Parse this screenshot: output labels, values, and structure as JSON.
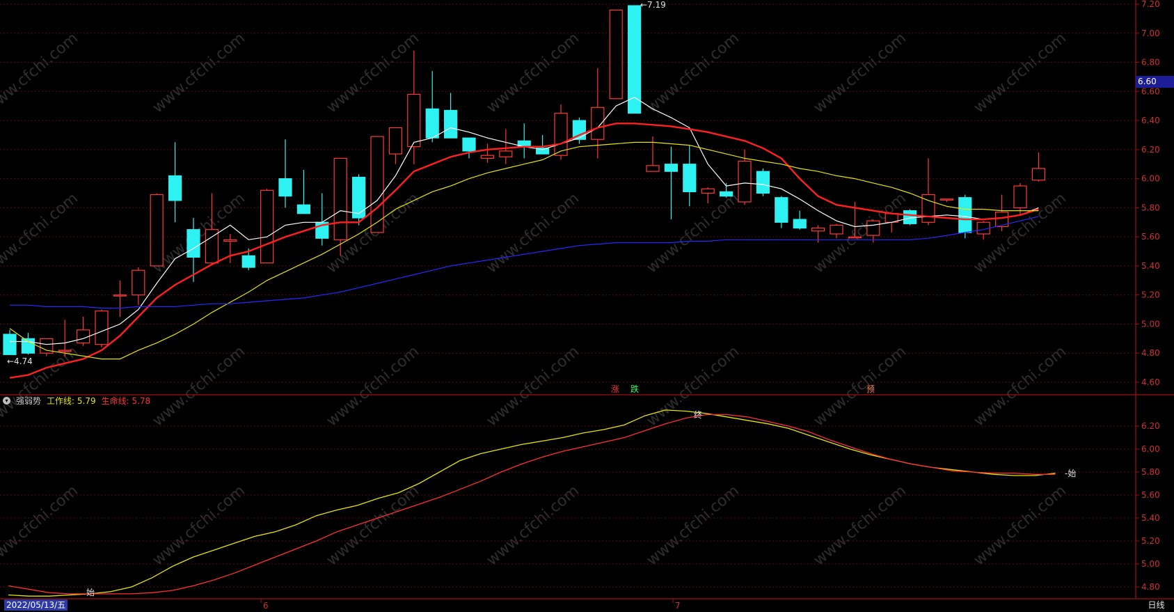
{
  "chart_data": [
    {
      "type": "candlestick",
      "panel": "price",
      "ylim": [
        4.6,
        7.2
      ],
      "yticks": [
        "4.60",
        "4.80",
        "5.00",
        "5.20",
        "5.40",
        "5.60",
        "5.80",
        "6.00",
        "6.20",
        "6.40",
        "6.60",
        "6.80",
        "7.00",
        "7.20"
      ],
      "grid": true,
      "candles": [
        {
          "o": 4.93,
          "h": 4.96,
          "l": 4.79,
          "c": 4.79
        },
        {
          "o": 4.9,
          "h": 4.94,
          "l": 4.79,
          "c": 4.8
        },
        {
          "o": 4.8,
          "h": 4.88,
          "l": 4.78,
          "c": 4.9
        },
        {
          "o": 4.82,
          "h": 5.03,
          "l": 4.78,
          "c": 4.82
        },
        {
          "o": 4.87,
          "h": 5.05,
          "l": 4.85,
          "c": 4.96
        },
        {
          "o": 4.86,
          "h": 5.1,
          "l": 4.84,
          "c": 5.09
        },
        {
          "o": 5.2,
          "h": 5.3,
          "l": 5.05,
          "c": 5.2
        },
        {
          "o": 5.2,
          "h": 5.39,
          "l": 5.13,
          "c": 5.37
        },
        {
          "o": 5.4,
          "h": 5.9,
          "l": 5.4,
          "c": 5.89
        },
        {
          "o": 6.02,
          "h": 6.25,
          "l": 5.7,
          "c": 5.85
        },
        {
          "o": 5.65,
          "h": 5.73,
          "l": 5.29,
          "c": 5.46
        },
        {
          "o": 5.42,
          "h": 5.9,
          "l": 5.41,
          "c": 5.65
        },
        {
          "o": 5.57,
          "h": 5.62,
          "l": 5.42,
          "c": 5.58
        },
        {
          "o": 5.47,
          "h": 5.52,
          "l": 5.37,
          "c": 5.39
        },
        {
          "o": 5.42,
          "h": 5.93,
          "l": 5.42,
          "c": 5.92
        },
        {
          "o": 6.0,
          "h": 6.27,
          "l": 5.8,
          "c": 5.88
        },
        {
          "o": 5.82,
          "h": 6.06,
          "l": 5.76,
          "c": 5.76
        },
        {
          "o": 5.7,
          "h": 5.9,
          "l": 5.54,
          "c": 5.59
        },
        {
          "o": 5.58,
          "h": 6.14,
          "l": 5.47,
          "c": 6.14
        },
        {
          "o": 6.01,
          "h": 6.03,
          "l": 5.68,
          "c": 5.73
        },
        {
          "o": 5.63,
          "h": 6.29,
          "l": 5.63,
          "c": 6.29
        },
        {
          "o": 6.17,
          "h": 6.35,
          "l": 6.1,
          "c": 6.35
        },
        {
          "o": 6.22,
          "h": 6.88,
          "l": 6.1,
          "c": 6.58
        },
        {
          "o": 6.48,
          "h": 6.74,
          "l": 6.25,
          "c": 6.28
        },
        {
          "o": 6.47,
          "h": 6.59,
          "l": 6.35,
          "c": 6.28
        },
        {
          "o": 6.28,
          "h": 6.2,
          "l": 6.14,
          "c": 6.19
        },
        {
          "o": 6.14,
          "h": 6.24,
          "l": 6.11,
          "c": 6.16
        },
        {
          "o": 6.15,
          "h": 6.34,
          "l": 6.1,
          "c": 6.19
        },
        {
          "o": 6.26,
          "h": 6.38,
          "l": 6.14,
          "c": 6.22
        },
        {
          "o": 6.21,
          "h": 6.3,
          "l": 6.18,
          "c": 6.17
        },
        {
          "o": 6.16,
          "h": 6.51,
          "l": 6.13,
          "c": 6.45
        },
        {
          "o": 6.4,
          "h": 6.42,
          "l": 6.24,
          "c": 6.27
        },
        {
          "o": 6.27,
          "h": 6.76,
          "l": 6.14,
          "c": 6.49
        },
        {
          "o": 6.55,
          "h": 7.16,
          "l": 6.55,
          "c": 7.16
        },
        {
          "o": 7.19,
          "h": 7.19,
          "l": 6.45,
          "c": 6.45
        },
        {
          "o": 6.05,
          "h": 6.29,
          "l": 6.05,
          "c": 6.09
        },
        {
          "o": 6.1,
          "h": 6.22,
          "l": 5.72,
          "c": 6.05
        },
        {
          "o": 6.1,
          "h": 6.23,
          "l": 5.81,
          "c": 5.91
        },
        {
          "o": 5.9,
          "h": 5.94,
          "l": 5.83,
          "c": 5.93
        },
        {
          "o": 5.91,
          "h": 5.97,
          "l": 5.87,
          "c": 5.88
        },
        {
          "o": 5.84,
          "h": 6.2,
          "l": 5.82,
          "c": 6.12
        },
        {
          "o": 6.05,
          "h": 6.07,
          "l": 5.88,
          "c": 5.9
        },
        {
          "o": 5.87,
          "h": 5.88,
          "l": 5.66,
          "c": 5.7
        },
        {
          "o": 5.72,
          "h": 5.78,
          "l": 5.65,
          "c": 5.66
        },
        {
          "o": 5.64,
          "h": 5.68,
          "l": 5.56,
          "c": 5.66
        },
        {
          "o": 5.62,
          "h": 5.69,
          "l": 5.59,
          "c": 5.68
        },
        {
          "o": 5.6,
          "h": 5.84,
          "l": 5.6,
          "c": 5.6
        },
        {
          "o": 5.61,
          "h": 5.72,
          "l": 5.56,
          "c": 5.71
        },
        {
          "o": 5.7,
          "h": 5.74,
          "l": 5.63,
          "c": 5.76
        },
        {
          "o": 5.78,
          "h": 5.79,
          "l": 5.68,
          "c": 5.69
        },
        {
          "o": 5.7,
          "h": 6.14,
          "l": 5.68,
          "c": 5.89
        },
        {
          "o": 5.86,
          "h": 5.86,
          "l": 5.84,
          "c": 5.86
        },
        {
          "o": 5.87,
          "h": 5.89,
          "l": 5.59,
          "c": 5.63
        },
        {
          "o": 5.62,
          "h": 5.71,
          "l": 5.58,
          "c": 5.7
        },
        {
          "o": 5.67,
          "h": 5.89,
          "l": 5.64,
          "c": 5.77
        },
        {
          "o": 5.8,
          "h": 5.97,
          "l": 5.75,
          "c": 5.95
        },
        {
          "o": 5.99,
          "h": 6.18,
          "l": 5.98,
          "c": 6.07
        }
      ],
      "series": [
        {
          "color": "#ffffff",
          "values": [
            4.88,
            4.88,
            4.86,
            4.87,
            4.9,
            4.95,
            5.0,
            5.1,
            5.28,
            5.45,
            5.52,
            5.6,
            5.68,
            5.58,
            5.6,
            5.68,
            5.7,
            5.7,
            5.78,
            5.76,
            5.85,
            6.02,
            6.25,
            6.28,
            6.35,
            6.32,
            6.28,
            6.25,
            6.22,
            6.2,
            6.24,
            6.28,
            6.35,
            6.5,
            6.56,
            6.48,
            6.42,
            6.35,
            6.1,
            5.95,
            5.97,
            5.96,
            5.93,
            5.86,
            5.78,
            5.71,
            5.67,
            5.68,
            5.7,
            5.73,
            5.74,
            5.75,
            5.74,
            5.72,
            5.73,
            5.75,
            5.8
          ]
        },
        {
          "color": "#ff2020",
          "values": [
            4.63,
            4.65,
            4.7,
            4.73,
            4.76,
            4.82,
            4.92,
            5.05,
            5.18,
            5.27,
            5.34,
            5.41,
            5.47,
            5.5,
            5.55,
            5.6,
            5.64,
            5.68,
            5.7,
            5.7,
            5.8,
            5.92,
            6.05,
            6.1,
            6.15,
            6.18,
            6.2,
            6.21,
            6.22,
            6.22,
            6.24,
            6.3,
            6.35,
            6.38,
            6.38,
            6.37,
            6.36,
            6.34,
            6.32,
            6.29,
            6.26,
            6.21,
            6.14,
            6.0,
            5.88,
            5.82,
            5.8,
            5.78,
            5.76,
            5.75,
            5.74,
            5.73,
            5.72,
            5.72,
            5.73,
            5.75,
            5.79
          ]
        },
        {
          "color": "#e6e600",
          "values": [
            4.97,
            4.88,
            4.82,
            4.8,
            4.78,
            4.76,
            4.76,
            4.82,
            4.87,
            4.93,
            5.0,
            5.08,
            5.15,
            5.22,
            5.3,
            5.36,
            5.42,
            5.48,
            5.55,
            5.62,
            5.7,
            5.79,
            5.85,
            5.91,
            5.95,
            6.0,
            6.04,
            6.07,
            6.1,
            6.13,
            6.19,
            6.22,
            6.23,
            6.24,
            6.25,
            6.25,
            6.24,
            6.23,
            6.2,
            6.17,
            6.14,
            6.12,
            6.1,
            6.07,
            6.05,
            6.02,
            6.0,
            5.97,
            5.94,
            5.9,
            5.85,
            5.81,
            5.79,
            5.79,
            5.78,
            5.78,
            5.78
          ]
        },
        {
          "color": "#2828ff",
          "values": [
            5.13,
            5.13,
            5.12,
            5.12,
            5.12,
            5.11,
            5.11,
            5.12,
            5.12,
            5.12,
            5.13,
            5.14,
            5.14,
            5.15,
            5.16,
            5.17,
            5.18,
            5.2,
            5.22,
            5.25,
            5.28,
            5.31,
            5.34,
            5.37,
            5.4,
            5.42,
            5.44,
            5.46,
            5.48,
            5.5,
            5.52,
            5.54,
            5.55,
            5.56,
            5.56,
            5.56,
            5.56,
            5.57,
            5.57,
            5.58,
            5.58,
            5.58,
            5.58,
            5.58,
            5.58,
            5.58,
            5.58,
            5.58,
            5.58,
            5.58,
            5.59,
            5.61,
            5.63,
            5.65,
            5.68,
            5.71,
            5.74
          ]
        }
      ],
      "annotations": {
        "high": "7.19",
        "low": "4.74",
        "signal_rise": "涨",
        "signal_fall": "跌",
        "signal_warn": "预"
      },
      "current_price": "6.60"
    },
    {
      "type": "line",
      "panel": "indicator",
      "title": "强弱势",
      "ylim": [
        4.6,
        6.4
      ],
      "yticks": [
        "4.80",
        "5.00",
        "5.20",
        "5.40",
        "5.60",
        "5.80",
        "6.00",
        "6.20"
      ],
      "grid": true,
      "legend": [
        {
          "label": "工作线: 5.79",
          "color": "#e6e600"
        },
        {
          "label": "生命线: 5.78",
          "color": "#ff3030"
        }
      ],
      "series": [
        {
          "name": "工作线",
          "color": "#e6e600",
          "values": [
            4.73,
            4.72,
            4.72,
            4.73,
            4.74,
            4.76,
            4.8,
            4.88,
            4.98,
            5.06,
            5.12,
            5.18,
            5.24,
            5.28,
            5.34,
            5.42,
            5.47,
            5.51,
            5.57,
            5.62,
            5.7,
            5.8,
            5.9,
            5.96,
            6.0,
            6.04,
            6.07,
            6.1,
            6.14,
            6.17,
            6.21,
            6.29,
            6.34,
            6.33,
            6.31,
            6.28,
            6.25,
            6.22,
            6.18,
            6.12,
            6.06,
            6.0,
            5.95,
            5.91,
            5.87,
            5.84,
            5.82,
            5.8,
            5.78,
            5.77,
            5.77,
            5.79
          ]
        },
        {
          "name": "生命线",
          "color": "#ff3030",
          "values": [
            4.81,
            4.78,
            4.75,
            4.74,
            4.74,
            4.74,
            4.74,
            4.75,
            4.77,
            4.81,
            4.86,
            4.92,
            4.99,
            5.06,
            5.13,
            5.2,
            5.28,
            5.34,
            5.4,
            5.46,
            5.52,
            5.58,
            5.65,
            5.72,
            5.8,
            5.87,
            5.93,
            5.98,
            6.02,
            6.06,
            6.1,
            6.16,
            6.22,
            6.27,
            6.3,
            6.3,
            6.28,
            6.24,
            6.2,
            6.15,
            6.08,
            6.02,
            5.96,
            5.91,
            5.87,
            5.84,
            5.81,
            5.8,
            5.79,
            5.79,
            5.78,
            5.78
          ]
        }
      ],
      "annotations": {
        "start_1": "始",
        "end": "终",
        "start_2": "始"
      }
    }
  ],
  "xaxis": {
    "date": "2022/05/13/五",
    "month_1": "6",
    "month_2": "7"
  },
  "period": "日线",
  "watermark": "www.cfchi.com"
}
